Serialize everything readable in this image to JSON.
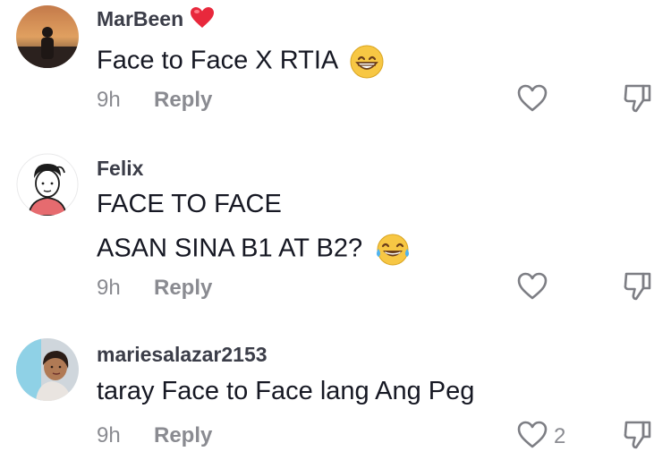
{
  "comments": [
    {
      "username": "MarBeen",
      "username_suffix_icon": "red-heart-emoji",
      "lines": [
        "Face to Face X RTIA"
      ],
      "emoji": "grinning-face-emoji",
      "time": "9h",
      "reply_label": "Reply",
      "like_count": ""
    },
    {
      "username": "Felix",
      "lines": [
        "FACE TO FACE",
        "ASAN SINA B1 AT B2?"
      ],
      "emoji": "tears-of-joy-emoji",
      "time": "9h",
      "reply_label": "Reply",
      "like_count": ""
    },
    {
      "username": "mariesalazar2153",
      "lines": [
        "taray Face to Face lang Ang Peg"
      ],
      "time": "9h",
      "reply_label": "Reply",
      "like_count": "2"
    }
  ],
  "colors": {
    "meta_text": "#8a8b91",
    "icon_stroke": "#7d7e84",
    "heart_red": "#e8283c"
  }
}
